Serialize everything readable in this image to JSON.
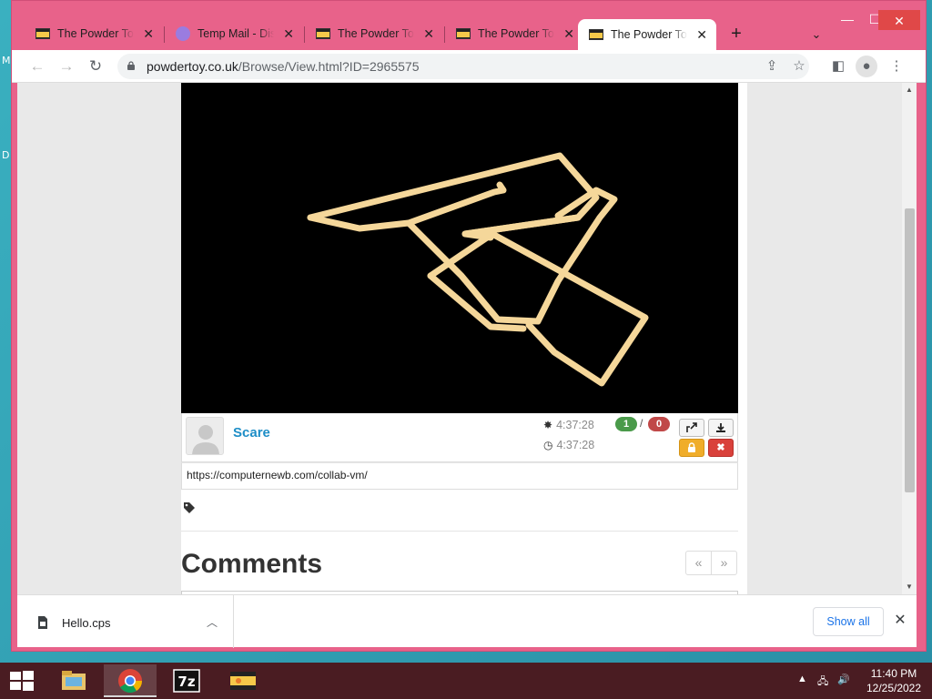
{
  "browser": {
    "tabs": [
      {
        "label": "The Powder Toy",
        "favicon": "powder-toy-favicon",
        "active": false
      },
      {
        "label": "Temp Mail - Disposable",
        "favicon": "temp-mail-favicon",
        "active": false
      },
      {
        "label": "The Powder Toy",
        "favicon": "powder-toy-favicon",
        "active": false
      },
      {
        "label": "The Powder Toy",
        "favicon": "powder-toy-favicon",
        "active": false
      },
      {
        "label": "The Powder Toy",
        "favicon": "powder-toy-favicon",
        "active": true
      }
    ],
    "url_host": "powdertoy.co.uk",
    "url_path": "/Browse/View.html?ID=2965575",
    "accent": "#e8628a"
  },
  "save": {
    "author": "Scare",
    "created_time": "4:37:28",
    "updated_time": "4:37:28",
    "votes_up": "1",
    "votes_down": "0",
    "votes_separator": "/",
    "description": "https://computernewb.com/collab-vm/"
  },
  "comments": {
    "title": "Comments",
    "prev": "«",
    "next": "»"
  },
  "downloads": {
    "file_name": "Hello.cps",
    "show_all": "Show all"
  },
  "taskbar": {
    "time": "11:40 PM",
    "date": "12/25/2022"
  },
  "desktop": {
    "fragments": [
      "M",
      "D"
    ]
  }
}
